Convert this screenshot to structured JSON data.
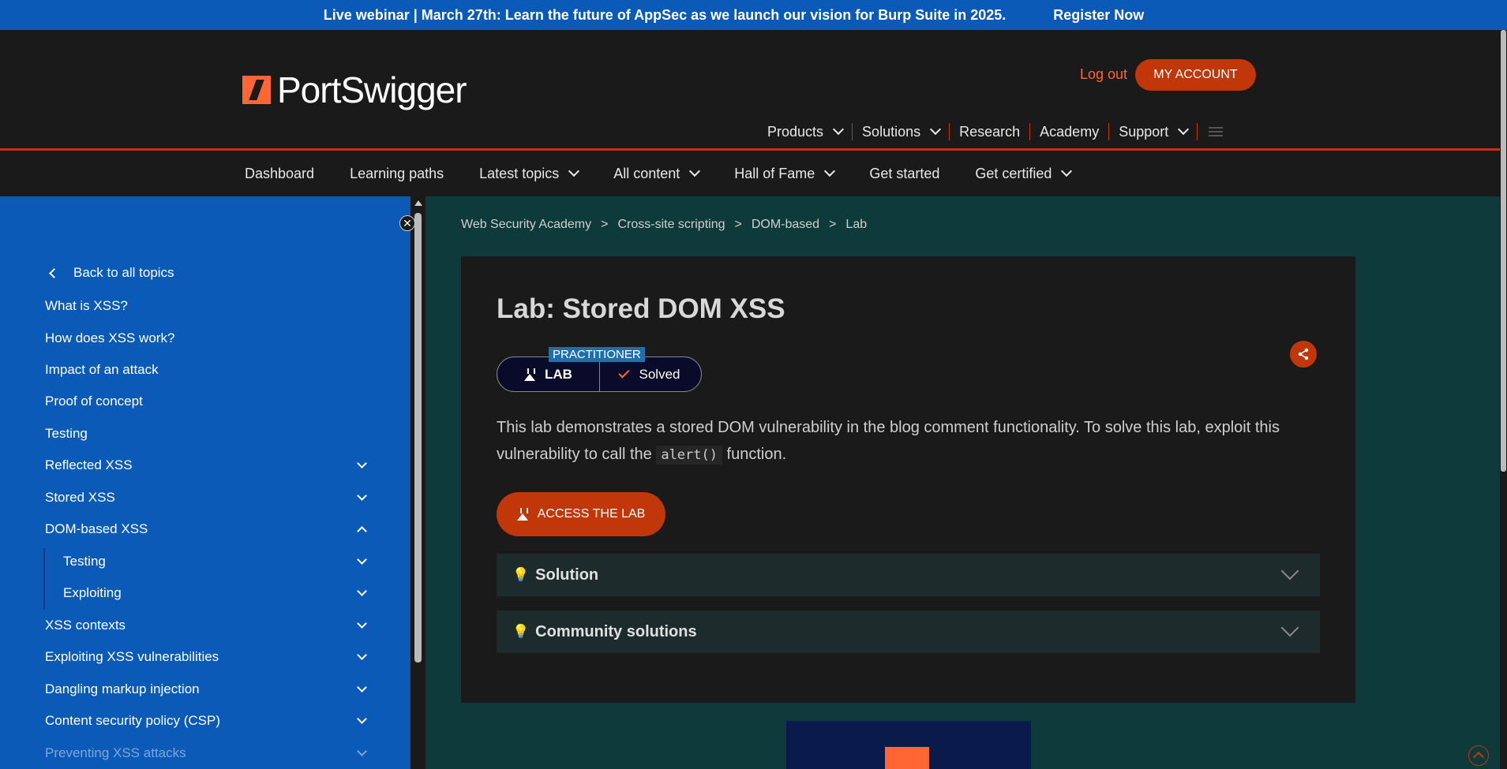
{
  "banner": {
    "text": "Live webinar | March 27th: Learn the future of AppSec as we launch our vision for Burp Suite in 2025.",
    "cta": "Register Now"
  },
  "header": {
    "logo": "PortSwigger",
    "logout": "Log out",
    "my_account": "MY ACCOUNT",
    "nav": [
      "Products",
      "Solutions",
      "Research",
      "Academy",
      "Support"
    ]
  },
  "subnav": [
    "Dashboard",
    "Learning paths",
    "Latest topics",
    "All content",
    "Hall of Fame",
    "Get started",
    "Get certified"
  ],
  "sidebar": {
    "back": "Back to all topics",
    "items": [
      "What is XSS?",
      "How does XSS work?",
      "Impact of an attack",
      "Proof of concept",
      "Testing",
      "Reflected XSS",
      "Stored XSS",
      "DOM-based XSS",
      "Testing",
      "Exploiting",
      "XSS contexts",
      "Exploiting XSS vulnerabilities",
      "Dangling markup injection",
      "Content security policy (CSP)",
      "Preventing XSS attacks"
    ]
  },
  "breadcrumb": [
    "Web Security Academy",
    "Cross-site scripting",
    "DOM-based",
    "Lab"
  ],
  "lab": {
    "title": "Lab: Stored DOM XSS",
    "level": "PRACTITIONER",
    "type": "LAB",
    "status": "Solved",
    "desc_before": "This lab demonstrates a stored DOM vulnerability in the blog comment functionality. To solve this lab, exploit this vulnerability to call the ",
    "code": "alert()",
    "desc_after": " function.",
    "access": "ACCESS THE LAB",
    "solution": "Solution",
    "community": "Community solutions"
  },
  "colors": {
    "brand": "#ff6633",
    "accent": "#c1370a",
    "banner": "#0b5ab8"
  }
}
